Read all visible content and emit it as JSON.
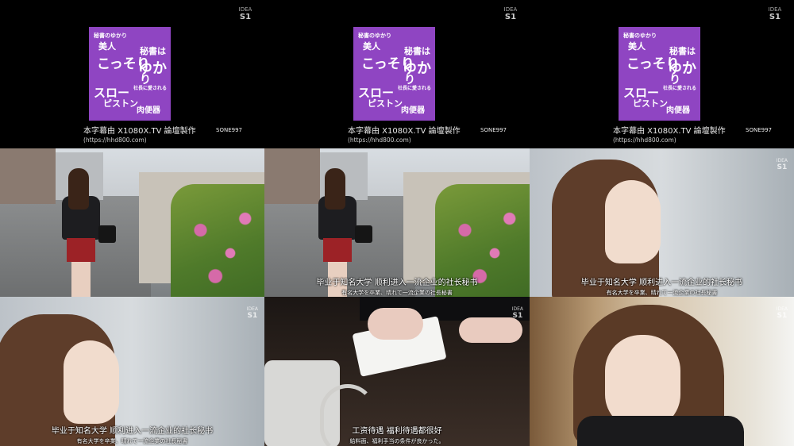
{
  "title_card": {
    "poster_lines": [
      "秘書のゆかり",
      "美人",
      "秘書は",
      "こっそり",
      "ゆか",
      "り",
      "社長に愛される",
      "スロー",
      "ピストン",
      "肉便器"
    ],
    "credit": "本字幕由 X1080X.TV 論壇製作",
    "url": "(https://hhd800.com)",
    "code": "SONE997",
    "logo_top": "IDEA",
    "logo_main": "S1"
  },
  "subtitles": {
    "line1_zh": "毕业于知名大学 顺利进入一流企业的社长秘书",
    "line1_jp": "有名大学を卒業、晴れて一流企業の社長秘書",
    "line2_zh": "工资待遇 福利待遇都很好",
    "line2_jp": "給料面、福利手当の条件が良かった。"
  },
  "watermark": {
    "top": "IDEA",
    "main": "S1"
  }
}
